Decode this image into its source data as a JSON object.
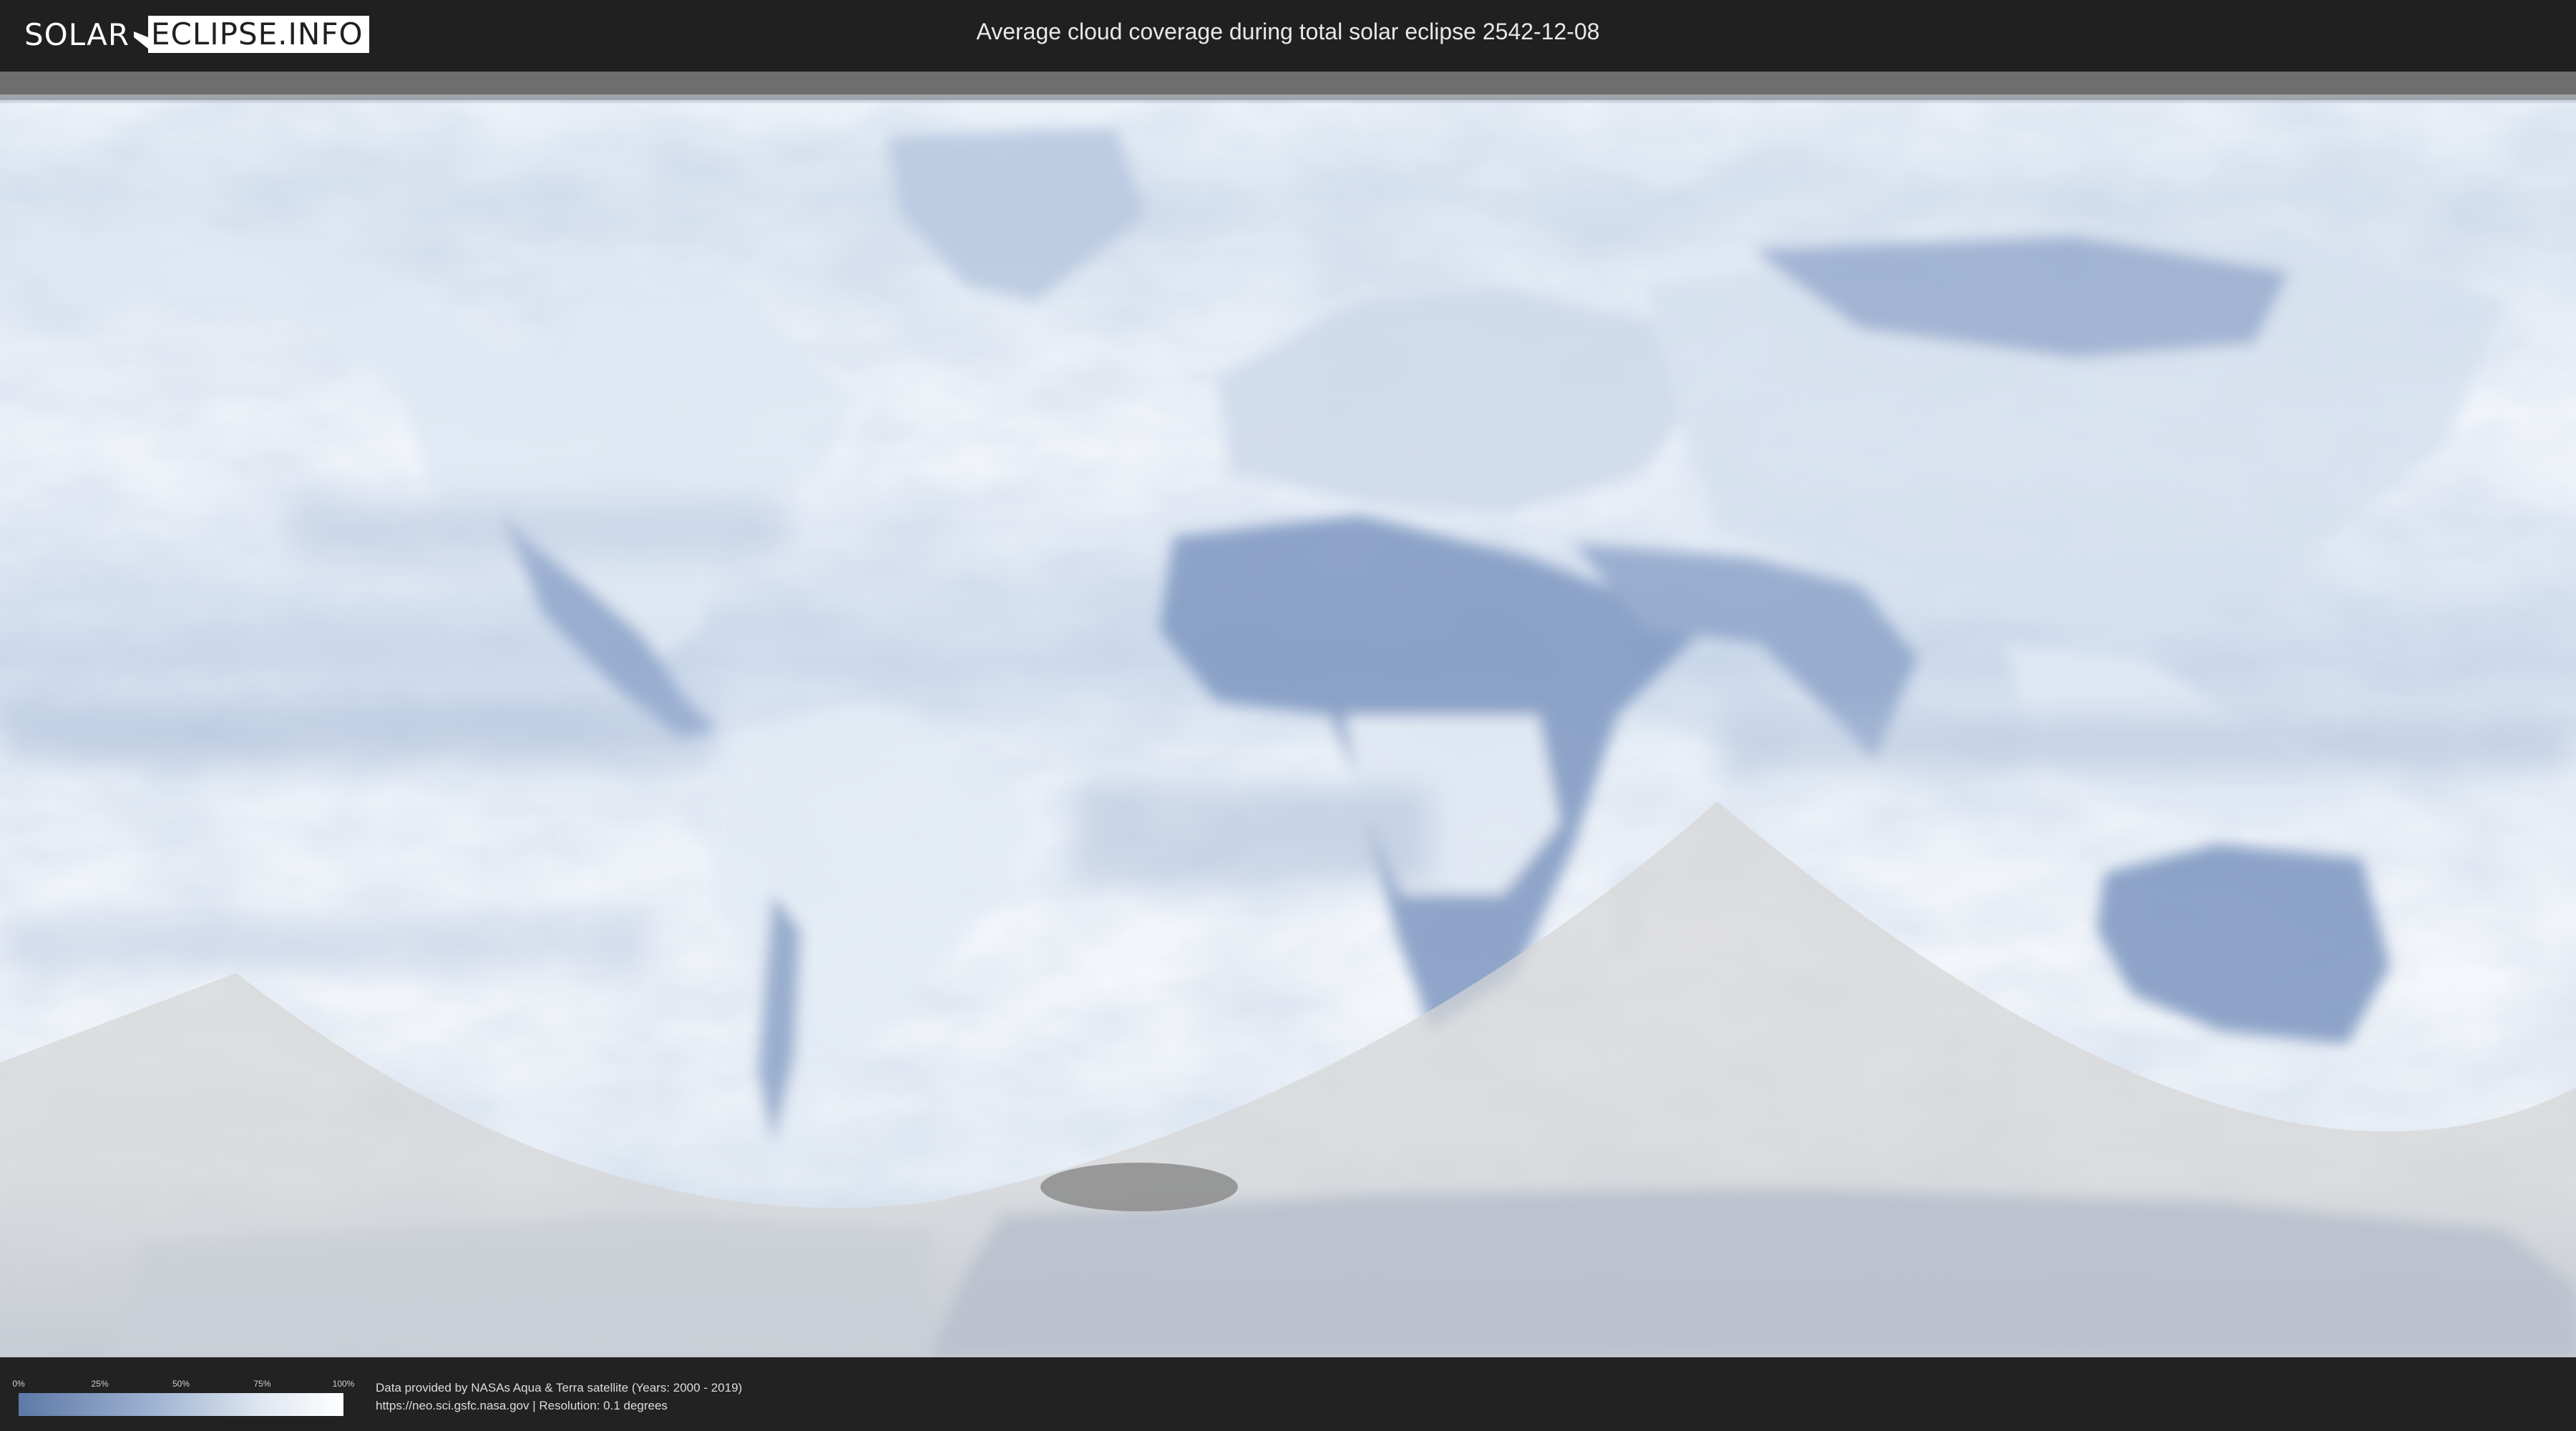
{
  "header": {
    "logo_part1": "SOLAR",
    "logo_part2": "ECLIPSE.INFO",
    "title": "Average cloud coverage during total solar eclipse 2542-12-08"
  },
  "legend": {
    "ticks": [
      "0%",
      "25%",
      "50%",
      "75%",
      "100%"
    ],
    "gradient_colors": [
      "#5d79a8",
      "#9cb1d0",
      "#dfe7f1",
      "#ffffff"
    ]
  },
  "attribution": {
    "line1": "Data provided by NASAs Aqua & Terra satellite (Years: 2000 - 2019)",
    "line2": "https://neo.sci.gsfc.nasa.gov | Resolution: 0.1 degrees"
  },
  "colors": {
    "cloud_clear": "#ffffff",
    "cloud_mid": "#c8d6e8",
    "cloud_dense": "#6e86b3",
    "night_overlay": "#d9d9d9",
    "umbra": "#8c8c8c"
  }
}
